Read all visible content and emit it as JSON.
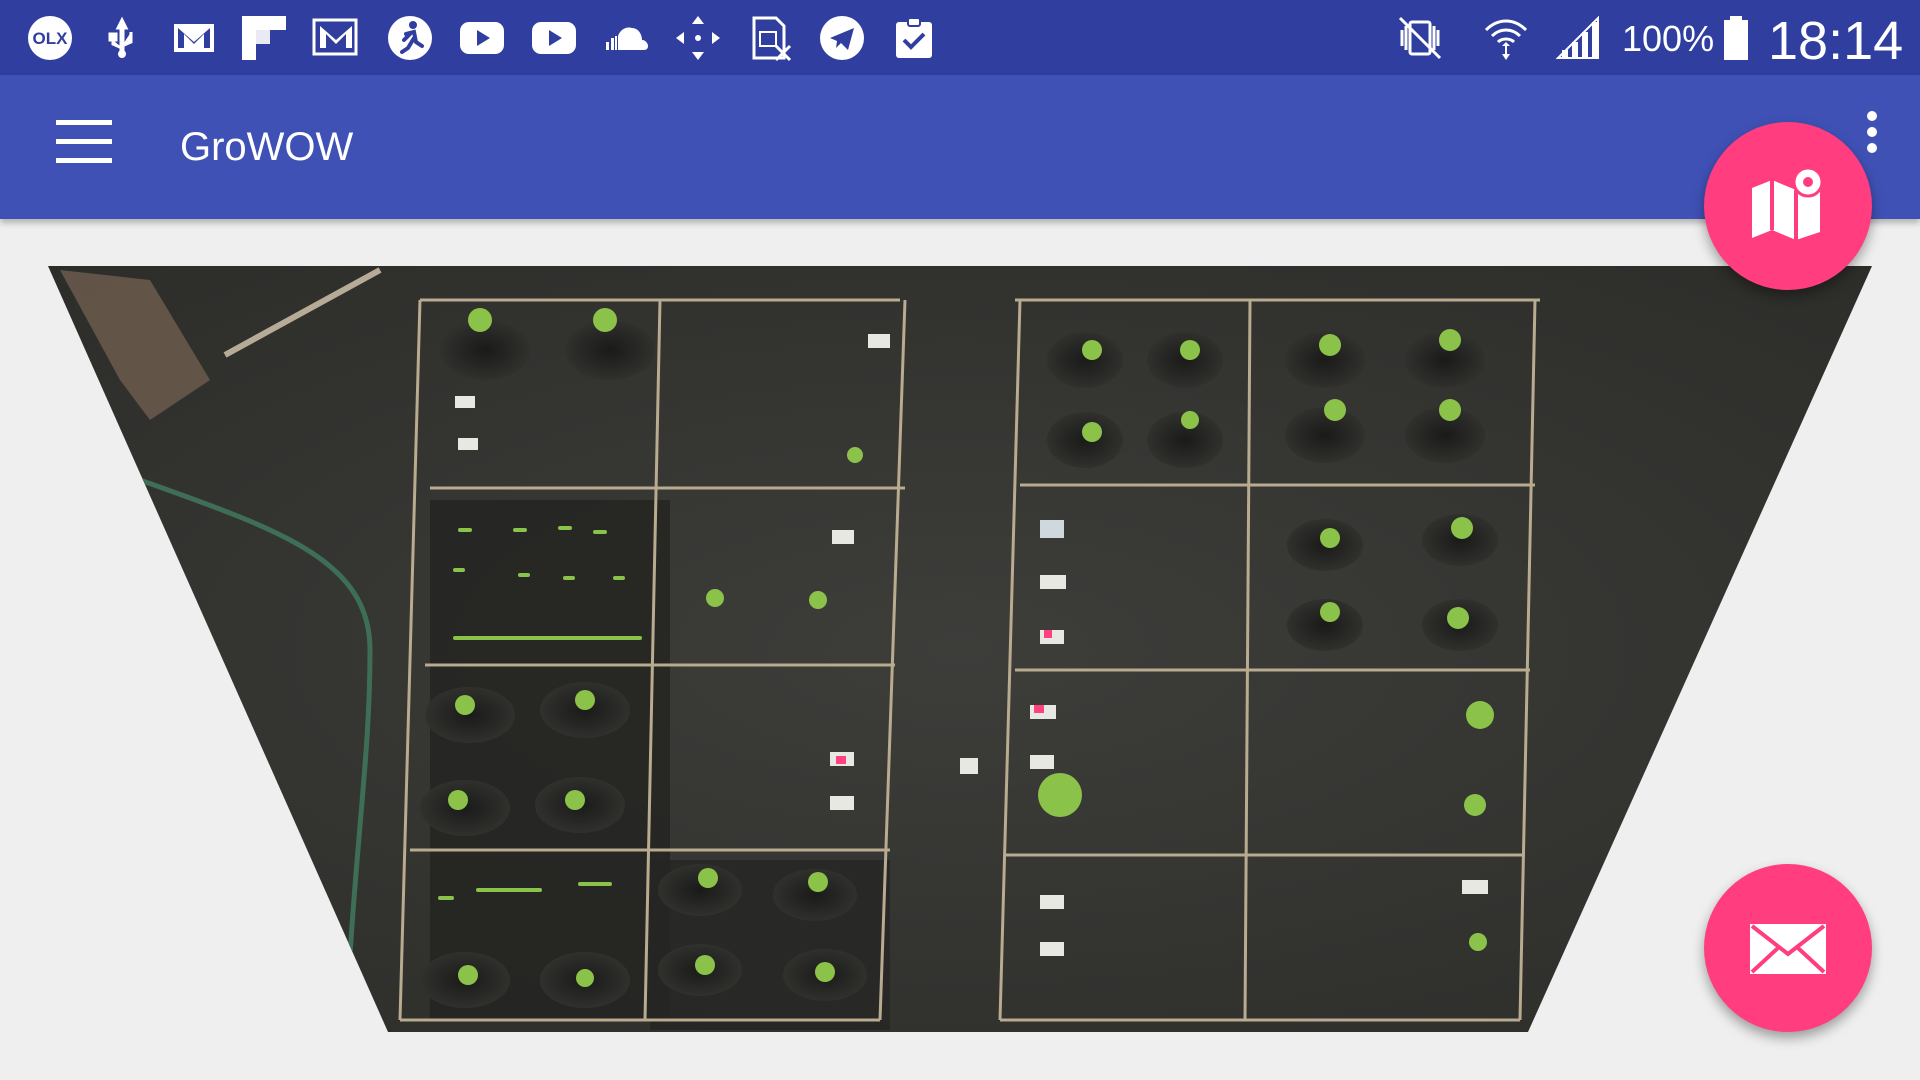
{
  "status_bar": {
    "left_icons": [
      "olx-icon",
      "usb-icon",
      "gmail-icon",
      "flipboard-icon",
      "gmail-icon",
      "runner-icon",
      "youtube-icon",
      "youtube-icon",
      "soundcloud-icon",
      "move-icon",
      "sim-x-icon",
      "telegram-icon",
      "clipboard-check-icon"
    ],
    "right_icons": [
      "vibrate-icon",
      "wifi-icon",
      "signal-icon",
      "battery-icon"
    ],
    "battery": "100%",
    "time": "18:14"
  },
  "app_bar": {
    "title": "GroWOW",
    "menu_icon": "hamburger-icon",
    "overflow_icon": "more-vert-icon"
  },
  "content": {
    "image": "garden-plot-aerial-photo"
  },
  "fabs": {
    "map_icon": "map-icon",
    "mail_icon": "mail-icon"
  },
  "colors": {
    "status_bar": "#303f9f",
    "app_bar": "#3f51b5",
    "accent": "#ff3d7f",
    "background": "#efefef"
  }
}
